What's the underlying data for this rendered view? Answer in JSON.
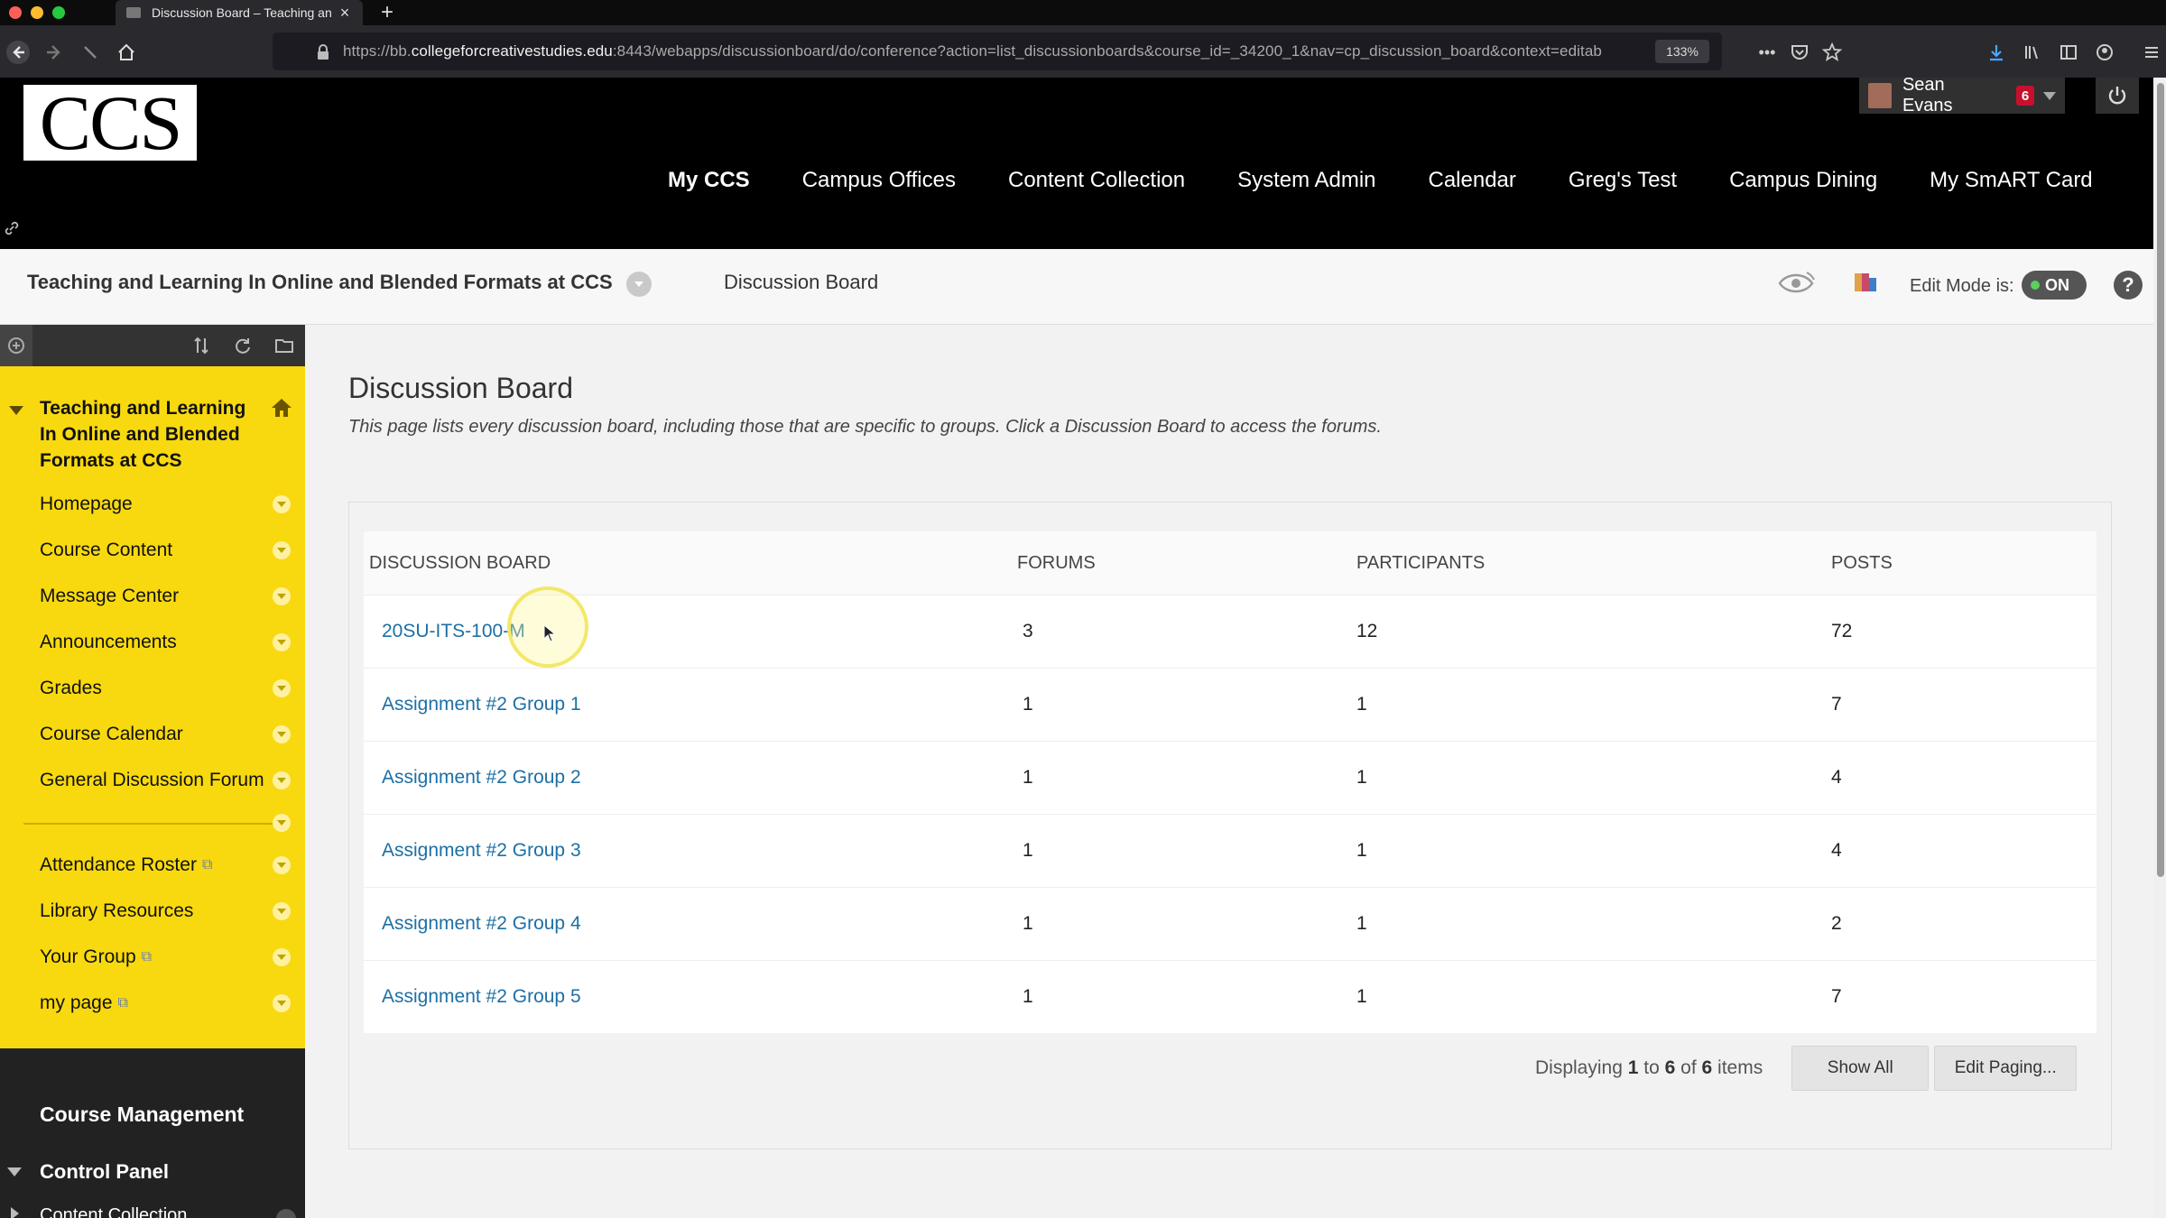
{
  "browser": {
    "tab_title": "Discussion Board – Teaching an",
    "url_host_prefix": "https://bb.",
    "url_host": "collegeforcreativestudies.edu",
    "url_rest": ":8443/webapps/discussionboard/do/conference?action=list_discussionboards&course_id=_34200_1&nav=cp_discussion_board&context=editab",
    "zoom": "133%",
    "overflow_menu": "•••"
  },
  "site": {
    "logo_text": "CCS",
    "user_name": "Sean Evans",
    "notification_count": "6",
    "nav": [
      {
        "label": "My CCS",
        "active": true
      },
      {
        "label": "Campus Offices"
      },
      {
        "label": "Content Collection"
      },
      {
        "label": "System Admin"
      },
      {
        "label": "Calendar"
      },
      {
        "label": "Greg's Test"
      },
      {
        "label": "Campus Dining"
      },
      {
        "label": "My SmART Card"
      }
    ]
  },
  "breadcrumb": {
    "course": "Teaching and Learning In Online and Blended Formats at CCS",
    "current": "Discussion Board",
    "edit_mode_label": "Edit Mode is:",
    "edit_mode_value": "ON",
    "help": "?"
  },
  "sidebar": {
    "course_name": "Teaching and Learning In Online and Blended Formats at CCS",
    "items": [
      {
        "label": "Homepage",
        "external": false
      },
      {
        "label": "Course Content",
        "external": false
      },
      {
        "label": "Message Center",
        "external": false
      },
      {
        "label": "Announcements",
        "external": false
      },
      {
        "label": "Grades",
        "external": false
      },
      {
        "label": "Course Calendar",
        "external": false
      },
      {
        "label": "General Discussion Forum",
        "external": false
      },
      {
        "label": "Attendance Roster",
        "external": true
      },
      {
        "label": "Library Resources",
        "external": false
      },
      {
        "label": "Your Group",
        "external": true
      },
      {
        "label": "my page",
        "external": true
      }
    ],
    "course_management": "Course Management",
    "control_panel": "Control Panel",
    "content_collection": "Content Collection"
  },
  "main": {
    "title": "Discussion Board",
    "description": "This page lists every discussion board, including those that are specific to groups. Click a Discussion Board to access the forums.",
    "columns": [
      "DISCUSSION BOARD",
      "FORUMS",
      "PARTICIPANTS",
      "POSTS"
    ],
    "rows": [
      {
        "name": "20SU-ITS-100-M",
        "forums": "3",
        "participants": "12",
        "posts": "72"
      },
      {
        "name": "Assignment #2 Group 1",
        "forums": "1",
        "participants": "1",
        "posts": "7"
      },
      {
        "name": "Assignment #2 Group 2",
        "forums": "1",
        "participants": "1",
        "posts": "4"
      },
      {
        "name": "Assignment #2 Group 3",
        "forums": "1",
        "participants": "1",
        "posts": "4"
      },
      {
        "name": "Assignment #2 Group 4",
        "forums": "1",
        "participants": "1",
        "posts": "2"
      },
      {
        "name": "Assignment #2 Group 5",
        "forums": "1",
        "participants": "1",
        "posts": "7"
      }
    ],
    "paging": {
      "prefix": "Displaying",
      "from": "1",
      "to_word": "to",
      "to": "6",
      "of_word": "of",
      "total": "6",
      "suffix": "items",
      "show_all": "Show All",
      "edit_paging": "Edit Paging..."
    }
  },
  "colors": {
    "sidebar": "#f8d90f",
    "header": "#000000",
    "link": "#1d6fa5",
    "badge": "#c8102e"
  }
}
